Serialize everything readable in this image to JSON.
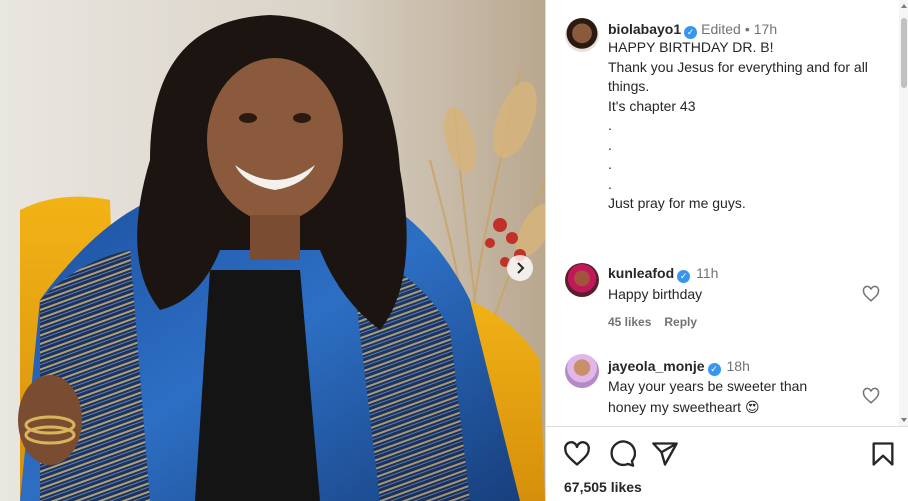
{
  "post": {
    "author": "biolabayo1",
    "edited_label": "Edited",
    "time": "17h",
    "caption_lines": [
      "HAPPY BIRTHDAY DR. B!",
      "Thank you Jesus for everything and for all things.",
      "It's chapter 43",
      ".",
      ".",
      ".",
      ".",
      "Just pray for me guys."
    ]
  },
  "comments": [
    {
      "user": "kunleafod",
      "time": "11h",
      "text": "Happy birthday",
      "likes": "45 likes",
      "reply": "Reply"
    },
    {
      "user": "jayeola_monje",
      "time": "18h",
      "text": "May your years be sweeter than honey my sweetheart 😍"
    }
  ],
  "likes_count": "67,505 likes",
  "colors": {
    "verified": "#3797f0",
    "muted_text": "#737373",
    "border": "#dbdbdb"
  },
  "icons": {
    "like": "heart-icon",
    "comment": "comment-icon",
    "share": "send-icon",
    "save": "bookmark-icon",
    "carousel": "chevron-right-icon"
  }
}
